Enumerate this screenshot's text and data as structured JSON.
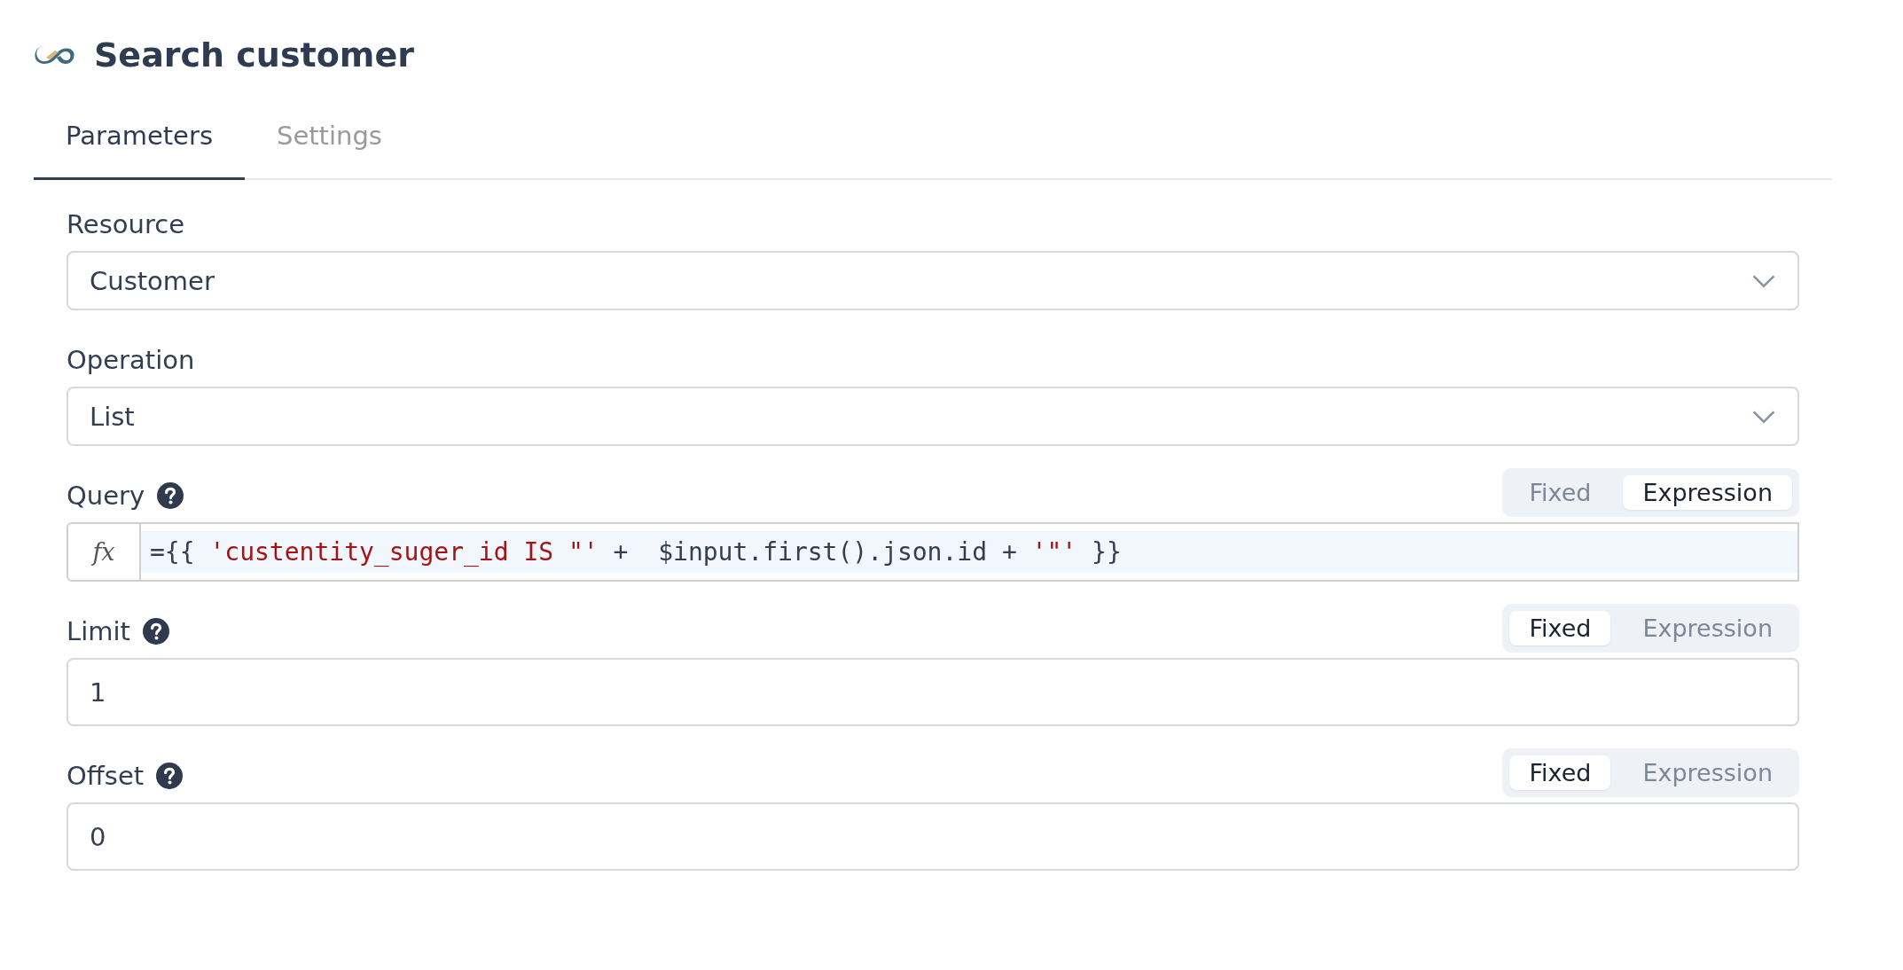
{
  "title": "Search customer",
  "tabs": [
    {
      "label": "Parameters",
      "selected": true
    },
    {
      "label": "Settings",
      "selected": false
    }
  ],
  "fields": [
    {
      "kind": "select",
      "label": "Resource",
      "value": "Customer"
    },
    {
      "kind": "select",
      "label": "Operation",
      "value": "List"
    },
    {
      "kind": "expression",
      "label": "Query",
      "help": true,
      "modes": [
        {
          "label": "Fixed",
          "selected": false
        },
        {
          "label": "Expression",
          "selected": true
        }
      ],
      "prefix": "fx",
      "code": [
        {
          "kind": "plain",
          "text": "={{ "
        },
        {
          "kind": "string",
          "text": "'custentity_suger_id IS \"'"
        },
        {
          "kind": "plain",
          "text": " +  $input.first().json.id + "
        },
        {
          "kind": "string",
          "text": "'\"'"
        },
        {
          "kind": "plain",
          "text": " }}"
        }
      ]
    },
    {
      "kind": "text",
      "label": "Limit",
      "help": true,
      "modes": [
        {
          "label": "Fixed",
          "selected": true
        },
        {
          "label": "Expression",
          "selected": false
        }
      ],
      "value": "1"
    },
    {
      "kind": "text",
      "label": "Offset",
      "help": true,
      "modes": [
        {
          "label": "Fixed",
          "selected": true
        },
        {
          "label": "Expression",
          "selected": false
        }
      ],
      "value": "0"
    }
  ]
}
